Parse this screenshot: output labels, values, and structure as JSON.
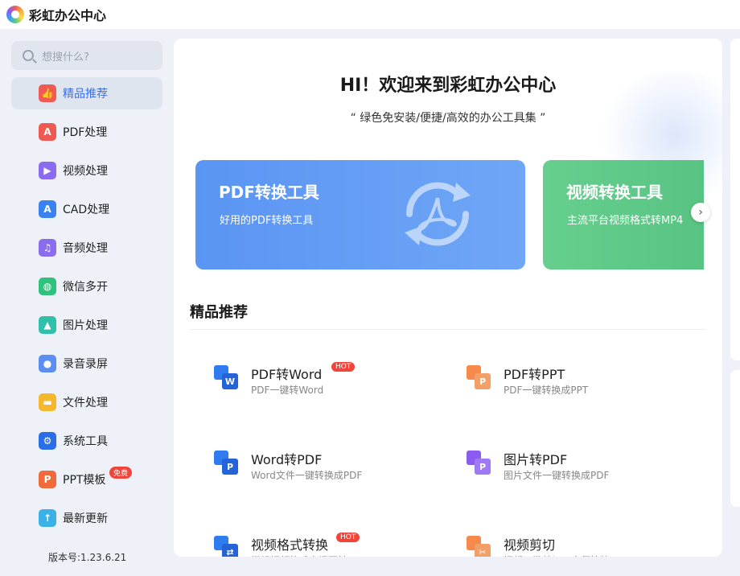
{
  "app": {
    "title": "彩虹办公中心"
  },
  "search": {
    "placeholder": "想搜什么?"
  },
  "sidebar": {
    "items": [
      {
        "label": "精品推荐",
        "icon": "thumbs-up-icon",
        "color": "#f05a55",
        "glyph": "👍"
      },
      {
        "label": "PDF处理",
        "icon": "pdf-icon",
        "color": "#ee5a52",
        "glyph": "A"
      },
      {
        "label": "视频处理",
        "icon": "play-icon",
        "color": "#8b6cf0",
        "glyph": "▶"
      },
      {
        "label": "CAD处理",
        "icon": "cad-icon",
        "color": "#3a82f0",
        "glyph": "A"
      },
      {
        "label": "音频处理",
        "icon": "music-icon",
        "color": "#8b6cf0",
        "glyph": "♫"
      },
      {
        "label": "微信多开",
        "icon": "wechat-icon",
        "color": "#2ec27e",
        "glyph": "◍"
      },
      {
        "label": "图片处理",
        "icon": "image-icon",
        "color": "#2ec0a8",
        "glyph": "▲"
      },
      {
        "label": "录音录屏",
        "icon": "microphone-icon",
        "color": "#5b8ef2",
        "glyph": "●"
      },
      {
        "label": "文件处理",
        "icon": "folder-icon",
        "color": "#f5b72c",
        "glyph": "▬"
      },
      {
        "label": "系统工具",
        "icon": "gear-icon",
        "color": "#2b6fe8",
        "glyph": "⚙"
      },
      {
        "label": "PPT模板",
        "icon": "ppt-icon",
        "color": "#f06a3a",
        "glyph": "P",
        "badge": "免费"
      },
      {
        "label": "最新更新",
        "icon": "upload-icon",
        "color": "#3ab2e8",
        "glyph": "↑"
      }
    ],
    "version": "版本号:1.23.6.21"
  },
  "main": {
    "welcome": "HI！欢迎来到彩虹办公中心",
    "slogan": "“ 绿色免安装/便捷/高效的办公工具集 ”",
    "banners": [
      {
        "title": "PDF转换工具",
        "subtitle": "好用的PDF转换工具"
      },
      {
        "title": "视频转换工具",
        "subtitle": "主流平台视频格式转MP4"
      }
    ],
    "section_title": "精品推荐",
    "tools": [
      {
        "name": "PDF转Word",
        "desc": "PDF一键转Word",
        "badge": "HOT",
        "color1": "#2f7cf0",
        "color2": "#2563d8",
        "glyph": "W"
      },
      {
        "name": "PDF转PPT",
        "desc": "PDF一键转换成PPT",
        "badge": "",
        "color1": "#f58a4a",
        "color2": "#f3a068",
        "glyph": "P"
      },
      {
        "name": "Word转PDF",
        "desc": "Word文件一键转换成PDF",
        "badge": "",
        "color1": "#2f7cf0",
        "color2": "#2563d8",
        "glyph": "P"
      },
      {
        "name": "图片转PDF",
        "desc": "图片文件一键转换成PDF",
        "badge": "",
        "color1": "#8b5cf0",
        "color2": "#a07af5",
        "glyph": "P"
      },
      {
        "name": "视频格式转换",
        "desc": "常规视频格式之间互转",
        "badge": "HOT",
        "color1": "#2f7cf0",
        "color2": "#2563d8",
        "glyph": "⇄"
      },
      {
        "name": "视频剪切",
        "desc": "视频一键剪切，方便快捷",
        "badge": "",
        "color1": "#f58a4a",
        "color2": "#f3a068",
        "glyph": "✂"
      }
    ]
  }
}
